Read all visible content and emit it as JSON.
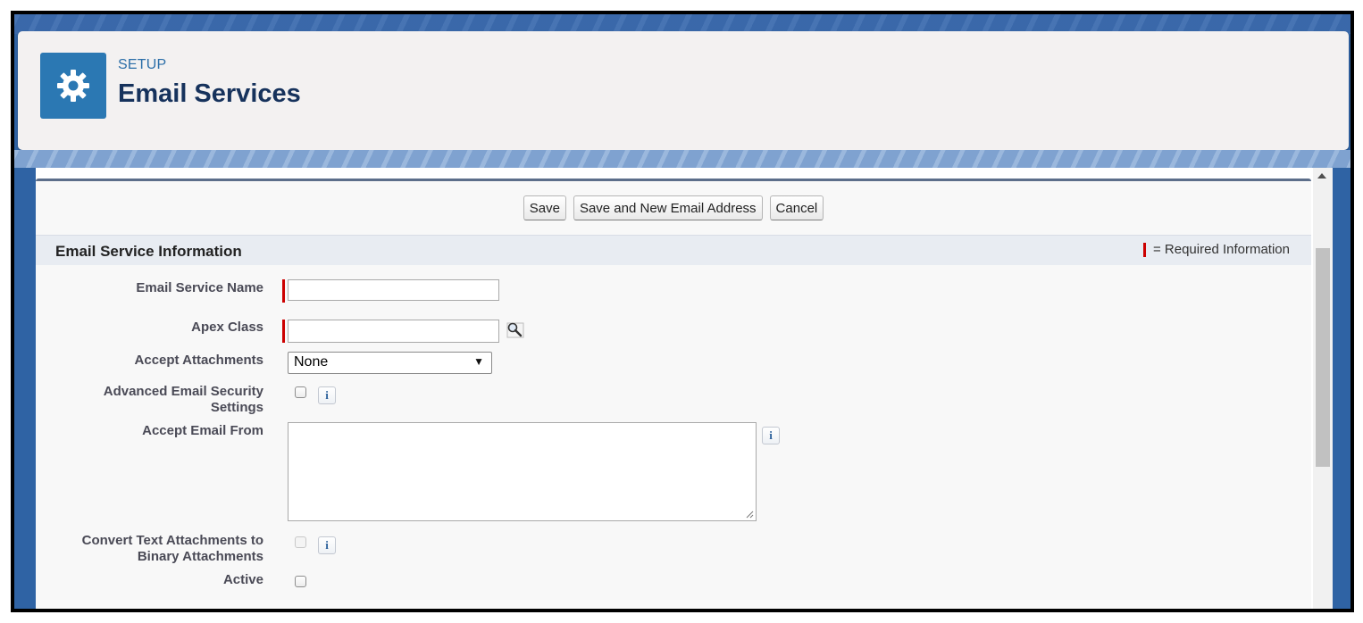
{
  "header": {
    "eyebrow": "SETUP",
    "title": "Email Services",
    "icon": "gear-icon"
  },
  "toolbar": {
    "save_label": "Save",
    "save_new_label": "Save and New Email Address",
    "cancel_label": "Cancel"
  },
  "section": {
    "title": "Email Service Information",
    "required_legend": "= Required Information"
  },
  "fields": {
    "email_service_name": {
      "label": "Email Service Name",
      "value": ""
    },
    "apex_class": {
      "label": "Apex Class",
      "value": "",
      "lookup_icon": "magnifier-lookup-icon"
    },
    "accept_attachments": {
      "label": "Accept Attachments",
      "selected": "None"
    },
    "advanced_security": {
      "label_line1": "Advanced Email Security",
      "label_line2": "Settings",
      "checked": false
    },
    "accept_email_from": {
      "label": "Accept Email From",
      "value": ""
    },
    "convert_text": {
      "label_line1": "Convert Text Attachments to",
      "label_line2": "Binary Attachments",
      "checked": false,
      "disabled": true
    },
    "active": {
      "label": "Active",
      "checked": false
    }
  },
  "info_glyph": "i",
  "colors": {
    "brand_blue": "#2b78b3",
    "title_navy": "#16325c",
    "required_red": "#c00000",
    "section_bg": "#e8ecf2"
  }
}
